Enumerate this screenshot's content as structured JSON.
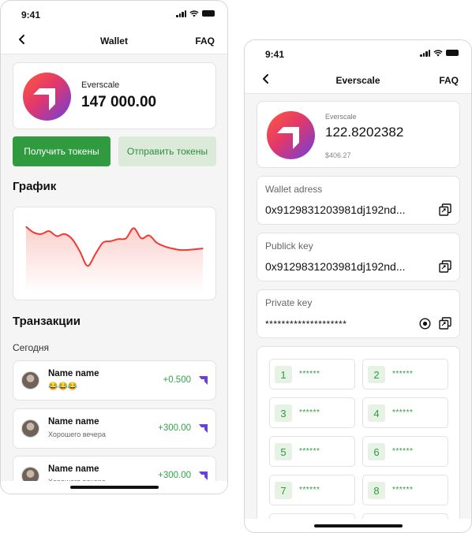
{
  "status_bar": {
    "time": "9:41"
  },
  "wallet_screen": {
    "title": "Wallet",
    "faq": "FAQ",
    "token_name": "Everscale",
    "balance": "147 000.00",
    "receive_button": "Получить токены",
    "send_button": "Отправить токены",
    "chart_title": "График",
    "transactions_title": "Транзакции",
    "today_label": "Сегодня",
    "transactions": [
      {
        "name": "Name name",
        "note": "😂😂😂",
        "amount": "+0.500"
      },
      {
        "name": "Name name",
        "note": "Хорошего вечера",
        "amount": "+300.00"
      },
      {
        "name": "Name name",
        "note": "Хорошего вечера",
        "amount": "+300.00"
      }
    ],
    "chart_data": {
      "type": "area",
      "title": "",
      "xlabel": "",
      "ylabel": "",
      "values": [
        0.82,
        0.74,
        0.72,
        0.76,
        0.69,
        0.72,
        0.65,
        0.48,
        0.28,
        0.44,
        0.6,
        0.62,
        0.65,
        0.66,
        0.8,
        0.66,
        0.7,
        0.6,
        0.55,
        0.52,
        0.5,
        0.5,
        0.51,
        0.52
      ],
      "ylim": [
        0,
        1
      ],
      "grid": false,
      "colors": {
        "line": "#ee3a33",
        "fill_top": "#fbd0cc",
        "fill_bottom": "#ffffff"
      }
    }
  },
  "details_screen": {
    "title": "Everscale",
    "faq": "FAQ",
    "token_name": "Everscale",
    "balance": "122.8202382",
    "usd_value": "$406.27",
    "wallet_address_label": "Wallet adress",
    "wallet_address": "0x9129831203981dj192nd...",
    "public_key_label": "Publick key",
    "public_key": "0x9129831203981dj192nd...",
    "private_key_label": "Private key",
    "private_key": "********************",
    "seed_words": [
      {
        "num": "1",
        "value": "******"
      },
      {
        "num": "2",
        "value": "******"
      },
      {
        "num": "3",
        "value": "******"
      },
      {
        "num": "4",
        "value": "******"
      },
      {
        "num": "5",
        "value": "******"
      },
      {
        "num": "6",
        "value": "******"
      },
      {
        "num": "7",
        "value": "******"
      },
      {
        "num": "8",
        "value": "******"
      }
    ]
  },
  "colors": {
    "primary_green": "#2f9a3e",
    "light_green": "#dcebd9",
    "amount_green": "#2fa34a",
    "chart_red": "#ee3a33",
    "brand_purple": "#6a3fe0"
  },
  "icons": [
    "back-arrow-icon",
    "signal-icon",
    "wifi-icon",
    "battery-icon",
    "everscale-logo-icon",
    "copy-icon",
    "eye-icon"
  ]
}
